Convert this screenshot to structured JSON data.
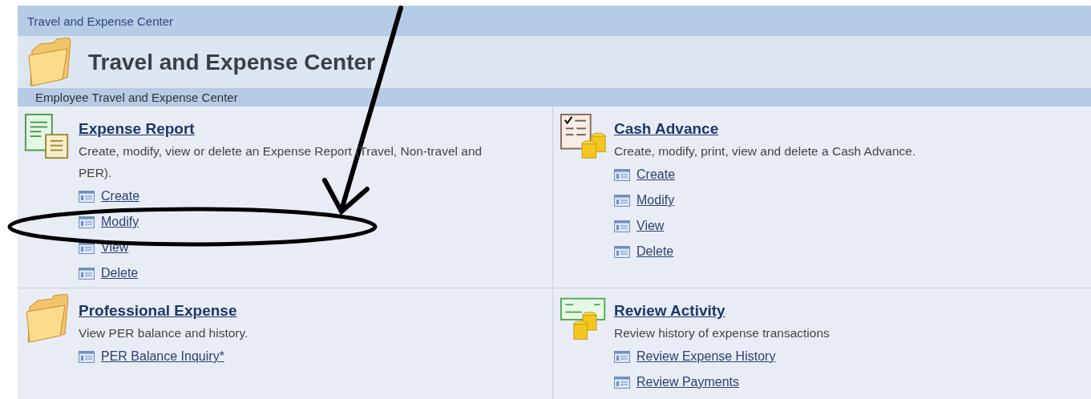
{
  "breadcrumb": "Travel and Expense Center",
  "page_title": "Travel and Expense Center",
  "section_header": "Employee Travel and Expense Center",
  "sections": [
    {
      "kind": "report",
      "title": "Expense Report",
      "description": "Create, modify, view or delete an Expense Report (Travel, Non-travel and PER).",
      "links": [
        "Create",
        "Modify",
        "View",
        "Delete"
      ]
    },
    {
      "kind": "cash",
      "title": "Cash Advance",
      "description": "Create, modify, print, view and delete a Cash Advance.",
      "links": [
        "Create",
        "Modify",
        "View",
        "Delete"
      ]
    },
    {
      "kind": "folder",
      "title": "Professional Expense",
      "description": "View PER balance and history.",
      "links": [
        "PER Balance Inquiry*"
      ]
    },
    {
      "kind": "review",
      "title": "Review Activity",
      "description": "Review history of expense transactions",
      "links": [
        "Review Expense History",
        "Review Payments"
      ]
    }
  ]
}
